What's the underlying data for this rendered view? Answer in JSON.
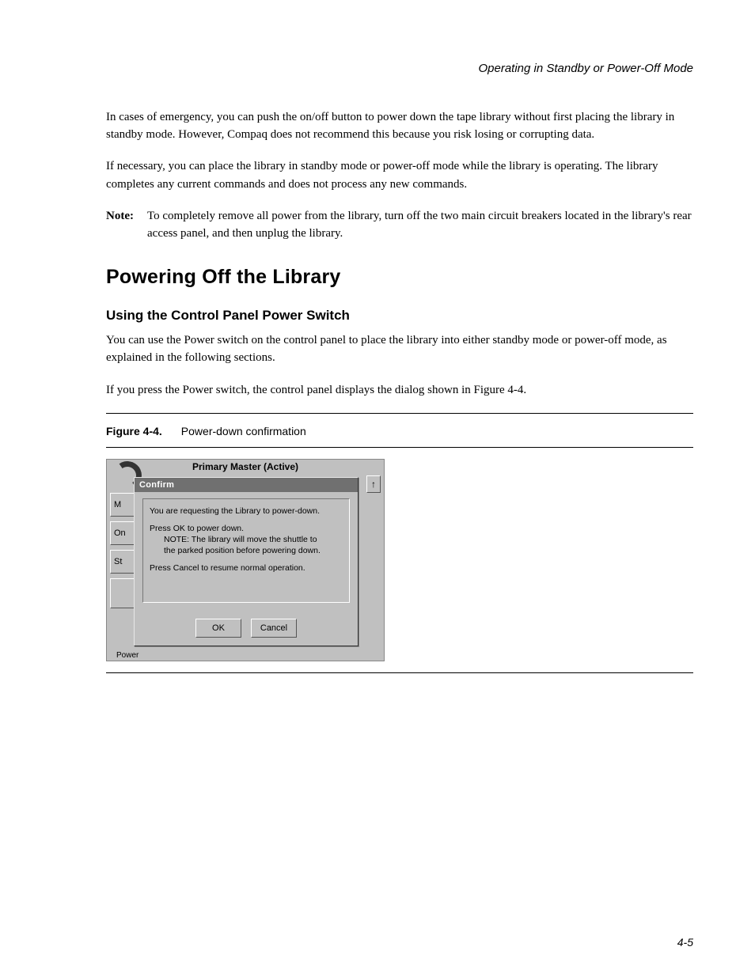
{
  "running_head": "Operating in Standby or Power-Off Mode",
  "para1": "In cases of emergency, you can push the on/off button to power down the tape library without first placing the library in standby mode. However, Compaq does not recommend this because you risk losing or corrupting data.",
  "para2": "If necessary, you can place the library in standby mode or power-off mode while the library is operating. The library completes any current commands and does not process any new commands.",
  "note_label": "Note:",
  "note_text": "To completely remove all power from the library, turn off the two main circuit breakers located in the library's rear access panel, and then unplug the library.",
  "h2": "Powering Off the Library",
  "h3": "Using the Control Panel Power Switch",
  "para3": "You can use the Power switch on the control panel to place the library into either standby mode or power-off mode, as explained in the following sections.",
  "para4": "If you press the Power switch, the control panel displays the dialog shown in Figure 4-4.",
  "fig_label": "Figure 4-4.",
  "fig_title": "Power-down confirmation",
  "page_number": "4-5",
  "dialog": {
    "window_title": "Primary Master (Active)",
    "modal_title": "Confirm",
    "line1": "You are requesting the Library to power-down.",
    "line2": "Press OK to power down.",
    "note1": "NOTE: The library will move the shuttle to",
    "note2": "the parked position before powering down.",
    "line3": "Press Cancel to resume normal operation.",
    "ok": "OK",
    "cancel": "Cancel",
    "bg_btn1": "M",
    "bg_btn2": "On",
    "bg_btn3": "St",
    "bg_power": "Power",
    "scroll_up": "↑"
  }
}
